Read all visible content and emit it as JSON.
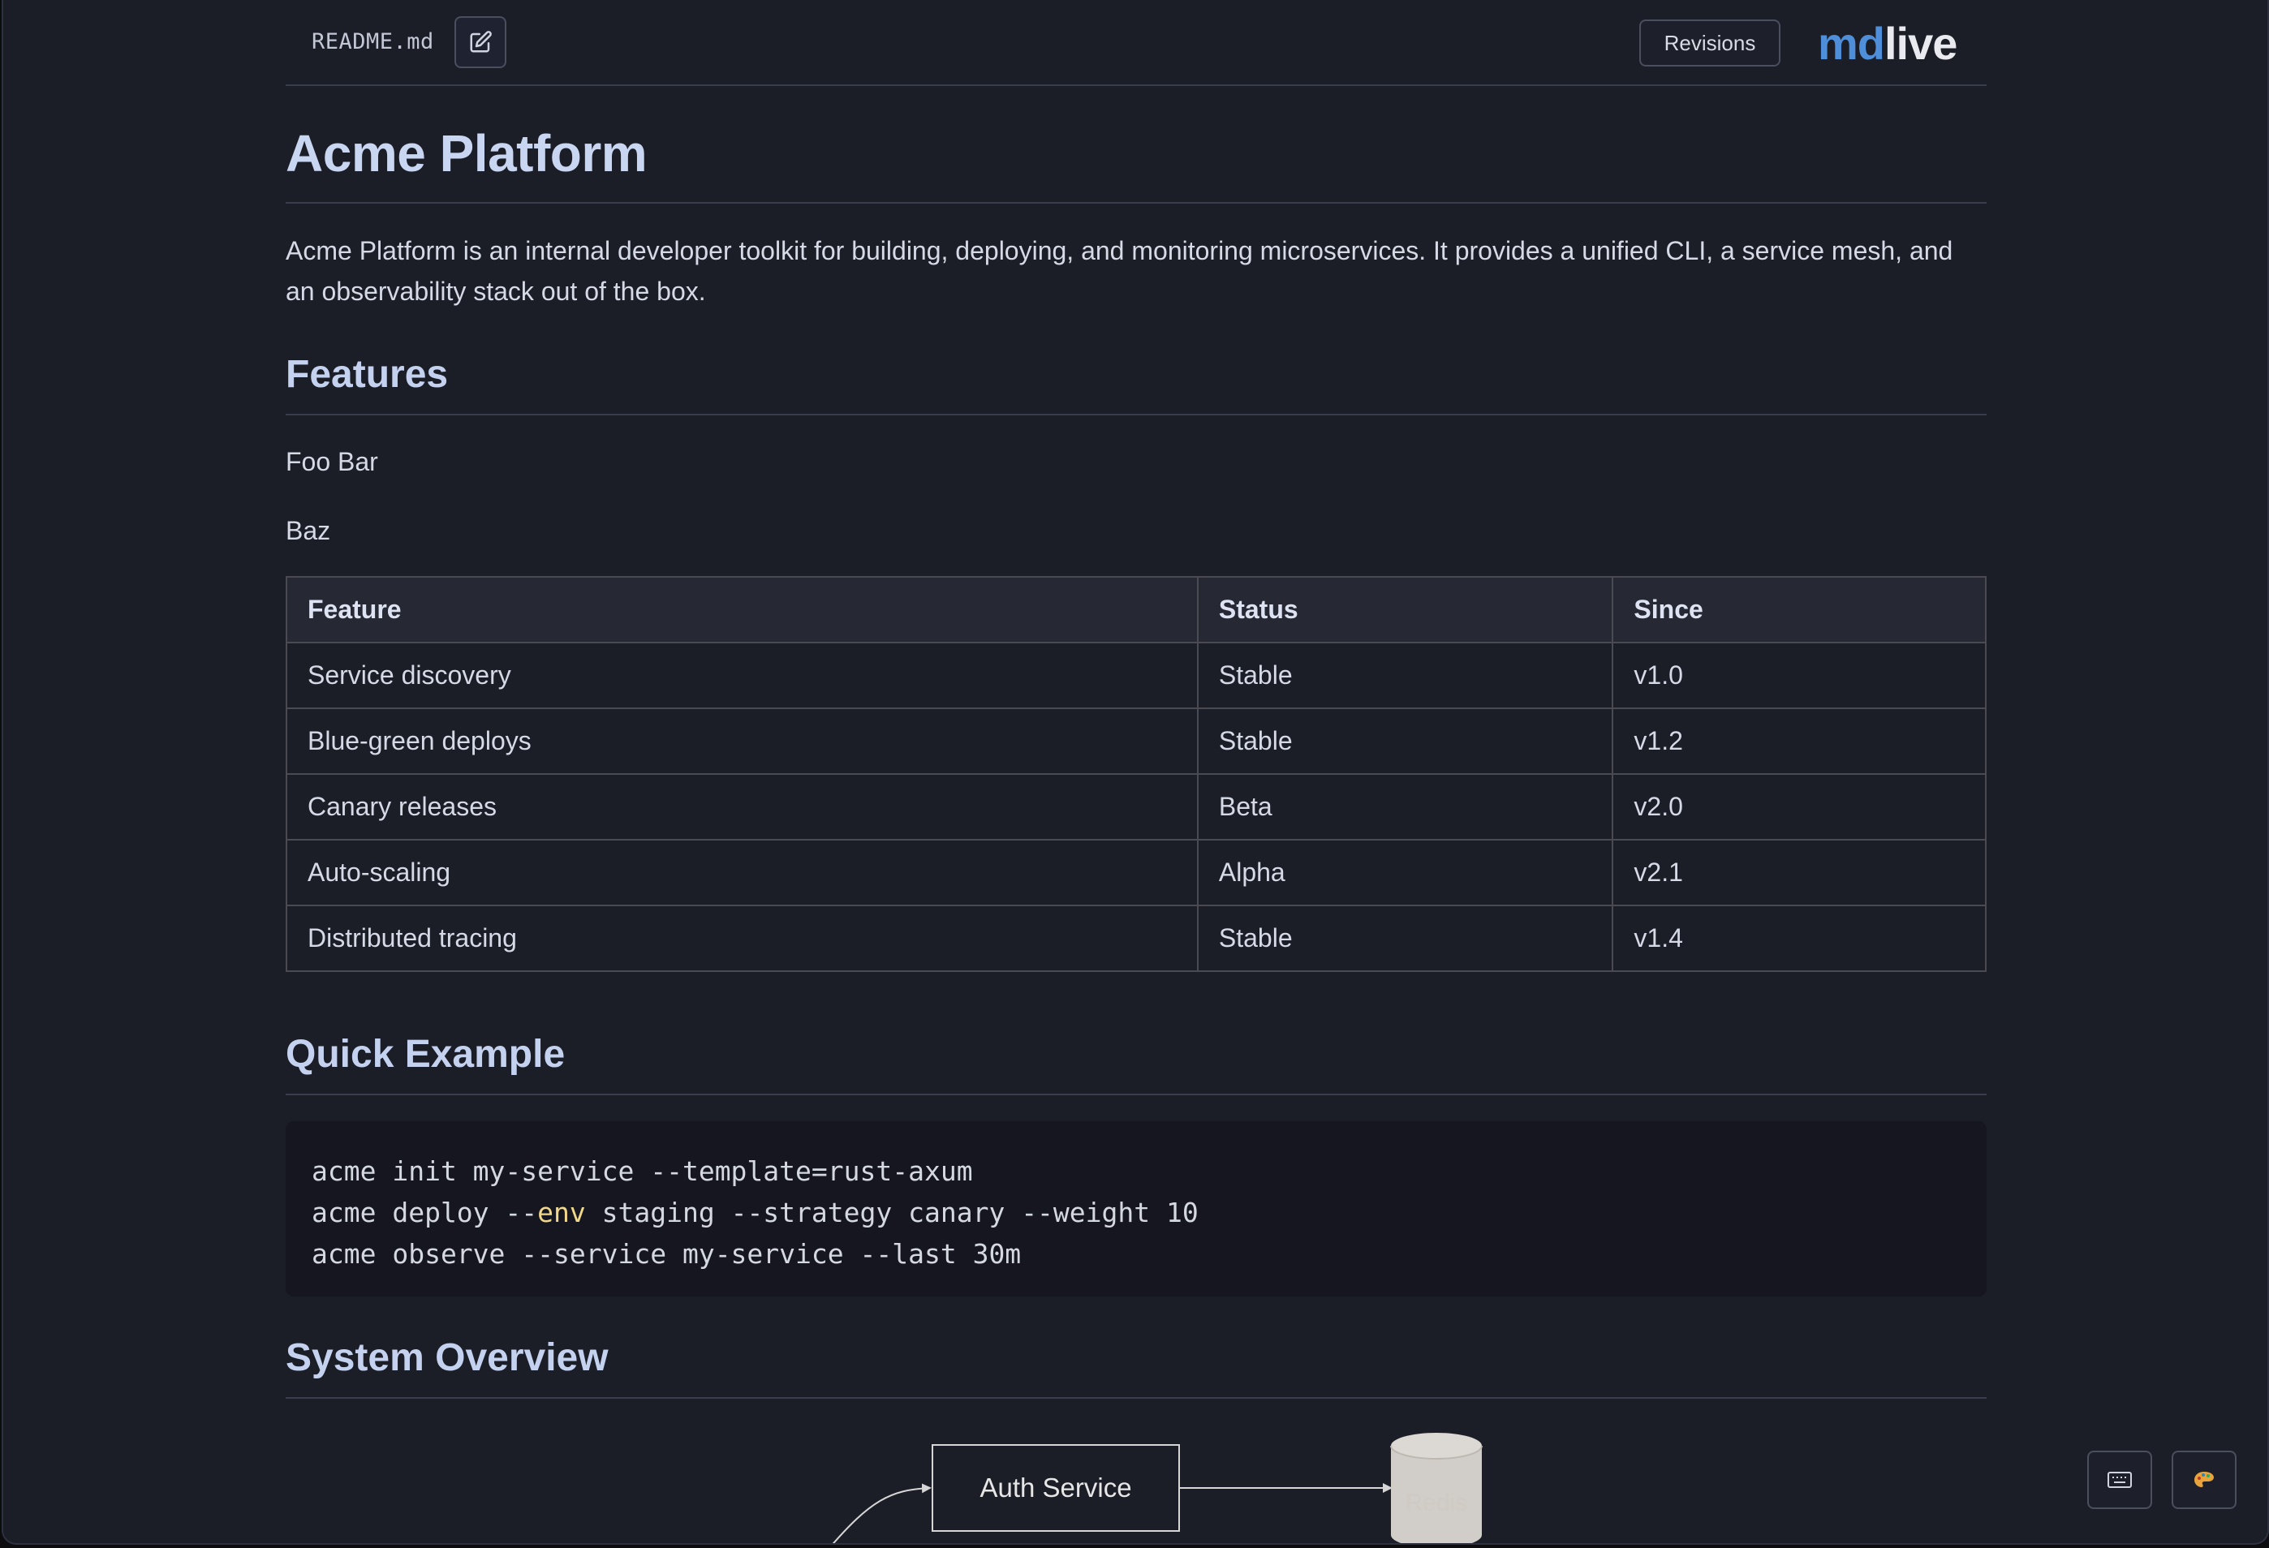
{
  "topbar": {
    "filename": "README.md",
    "edit_icon": "pencil-square-icon",
    "revisions_label": "Revisions",
    "logo": {
      "part1": "md",
      "part2": "live"
    }
  },
  "doc": {
    "title": "Acme Platform",
    "intro_line1": "Acme Platform is an internal developer toolkit for building, deploying, and monitoring microservices. It provides a unified CLI, a service mesh, and",
    "intro_line2": "an observability stack out of the box.",
    "features_heading": "Features",
    "features_line1": "Foo Bar",
    "features_line2": "Baz",
    "table": {
      "headers": [
        "Feature",
        "Status",
        "Since"
      ],
      "rows": [
        [
          "Service discovery",
          "Stable",
          "v1.0"
        ],
        [
          "Blue-green deploys",
          "Stable",
          "v1.2"
        ],
        [
          "Canary releases",
          "Beta",
          "v2.0"
        ],
        [
          "Auto-scaling",
          "Alpha",
          "v2.1"
        ],
        [
          "Distributed tracing",
          "Stable",
          "v1.4"
        ]
      ]
    },
    "quick_example_heading": "Quick Example",
    "code": {
      "line1": "acme init my-service --template=rust-axum",
      "line2_a": "acme deploy --",
      "line2_kw": "env",
      "line2_b": " staging --strategy canary --weight 10",
      "line3": "acme observe --service my-service --last 30m"
    },
    "system_overview_heading": "System Overview",
    "diagram": {
      "auth_service": "Auth Service",
      "redis": "Redis"
    }
  },
  "floating": {
    "keyboard_icon": "keyboard-icon",
    "theme_icon": "palette-icon"
  },
  "colors": {
    "background": "#1b1d27",
    "heading": "#c9d6f2",
    "logo_md": "#4f8fd9",
    "code_keyword": "#f0d78a"
  }
}
